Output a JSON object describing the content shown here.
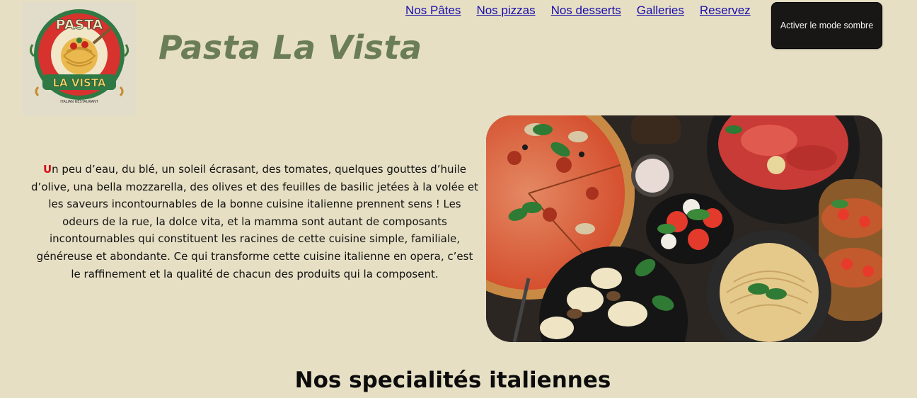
{
  "header": {
    "logo_text_top": "PASTA",
    "logo_text_bottom": "LA VISTA",
    "logo_tagline": "ITALIAN RESTAURANT",
    "site_title": "Pasta La Vista"
  },
  "nav": {
    "items": [
      "Nos Pâtes",
      "Nos pizzas",
      "Nos desserts",
      "Galleries",
      "Reservez"
    ]
  },
  "theme_toggle": {
    "label": "Activer le mode sombre"
  },
  "intro": {
    "dropcap": "U",
    "text": "n peu d’eau, du blé, un soleil écrasant, des tomates, quelques gouttes d’huile d’olive, una bella mozzarella, des olives et des feuilles de basilic jetées à la volée et les saveurs incontournables de la bonne cuisine italienne prennent sens ! Les odeurs de la rue, la dolce vita, et la mamma sont autant de composants incontournables qui constituent les racines de cette cuisine simple, familiale, généreuse et abondante. Ce qui transforme cette cuisine italienne en opera, c’est le raffinement et la qualité de chacun des produits qui la composent."
  },
  "section": {
    "title": "Nos specialités italiennes"
  },
  "colors": {
    "background": "#e6dfc4",
    "title": "#6b7d57",
    "link": "#1a0dab",
    "dropcap": "#d40f14",
    "button_bg": "#181716"
  }
}
